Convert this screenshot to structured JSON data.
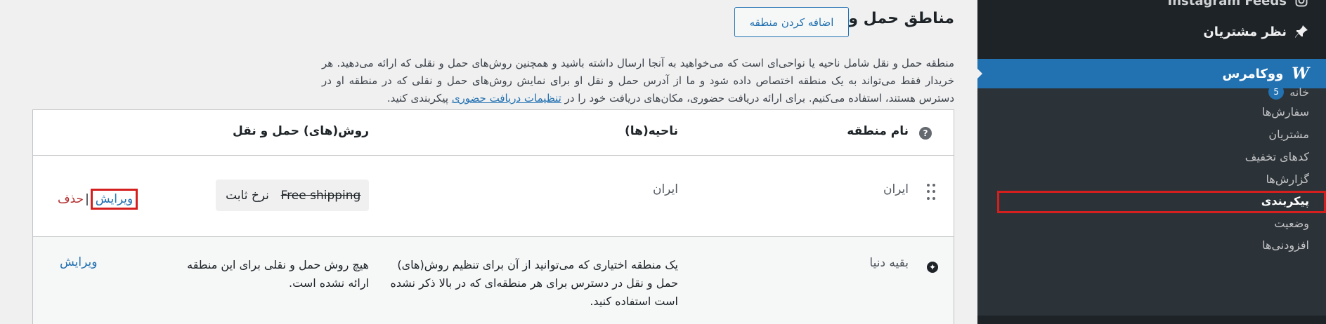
{
  "sidebar": {
    "cut_item": "Instagram Feeds",
    "review_item": "نظر مشتریان",
    "woo_label": "ووکامرس",
    "woo_logo": "W",
    "sub_items": [
      {
        "label": "خانه",
        "badge": "5"
      },
      {
        "label": "سفارش‌ها"
      },
      {
        "label": "مشتریان"
      },
      {
        "label": "کدهای تخفیف"
      },
      {
        "label": "گزارش‌ها"
      },
      {
        "label": "پیکربندی"
      },
      {
        "label": "وضعیت"
      },
      {
        "label": "افزودنی‌ها"
      }
    ]
  },
  "header": {
    "title": "مناطق حمل و نقل",
    "add_button": "اضافه کردن منطقه"
  },
  "description": {
    "text": "منطقه حمل و نقل شامل ناحیه یا نواحی‌ای است که می‌خواهید به آنجا ارسال داشته باشید و همچنین روش‌های حمل و نقلی که ارائه می‌دهید. هر خریدار فقط می‌تواند به یک منطقه اختصاص داده شود و ما از آدرس حمل و نقل او برای نمایش روش‌های حمل و نقلی که در منطقه او در دسترس هستند، استفاده می‌کنیم. برای ارائه دریافت حضوری، مکان‌های دریافت خود را در",
    "link": "تنظیمات دریافت حضوری",
    "suffix": "پیکربندی کنید."
  },
  "table": {
    "columns": [
      "نام منطقه",
      "ناحیه(ها)",
      "روش(های) حمل و نقل"
    ],
    "help_icon": "?",
    "rows": [
      {
        "zone": "ایران",
        "regions": "ایران",
        "methods": [
          "Free shipping",
          "نرخ ثابت"
        ],
        "edit": "ویرایش",
        "separator": "|",
        "delete": "حذف"
      },
      {
        "zone": "بقیه دنیا",
        "regions": "یک منطقه اختیاری که می‌توانید از آن برای تنظیم روش(های) حمل و نقل در دسترس برای هر منطقه‌ای که در بالا ذکر نشده است استفاده کنید.",
        "methods_empty": "هیچ روش حمل و نقلی برای این منطقه ارائه نشده است.",
        "edit": "ویرایش"
      }
    ]
  },
  "colors": {
    "accent": "#2271b1",
    "sidebar_bg": "#1d2327",
    "highlight": "#d51f1f",
    "delete": "#b32d2e"
  }
}
